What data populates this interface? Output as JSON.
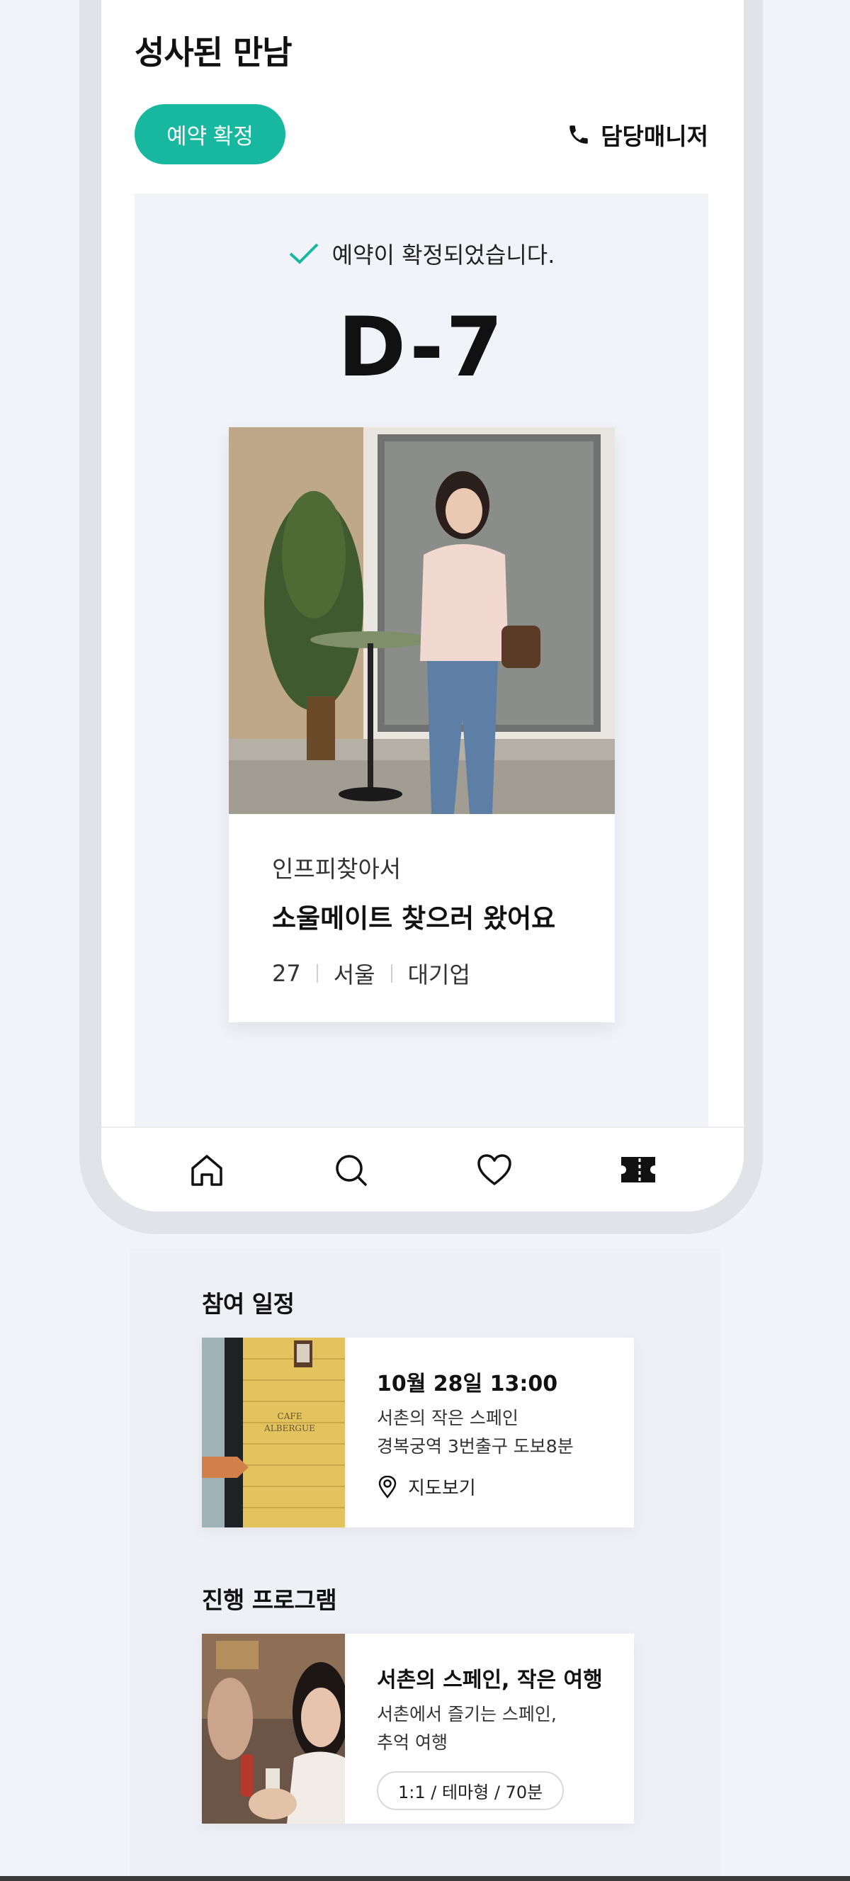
{
  "app": {
    "title": "성사된 만남",
    "status_chip": "예약 확정",
    "manager_label": "담당매니저"
  },
  "confirmation": {
    "message": "예약이 확정되었습니다.",
    "dday": "D-7"
  },
  "profile": {
    "tag": "인프피찾아서",
    "headline": "소울메이트 찾으러 왔어요",
    "meta": [
      "27",
      "서울",
      "대기업"
    ]
  },
  "tabs": [
    "home-icon",
    "search-icon",
    "heart-icon",
    "ticket-icon"
  ],
  "schedule": {
    "section_title": "참여 일정",
    "datetime": "10월 28일 13:00",
    "venue": "서촌의 작은 스페인",
    "directions": "경복궁역 3번출구 도보8분",
    "map_link": "지도보기",
    "thumb_sign": "CAFE ALBERGUE"
  },
  "program": {
    "section_title": "진행 프로그램",
    "title": "서촌의 스페인, 작은 여행",
    "desc_line1": "서촌에서 즐기는 스페인,",
    "desc_line2": "추억 여행",
    "tag": "1:1 / 테마형 / 70분"
  },
  "colors": {
    "accent": "#18b8a0",
    "background": "#f2f3f9"
  }
}
